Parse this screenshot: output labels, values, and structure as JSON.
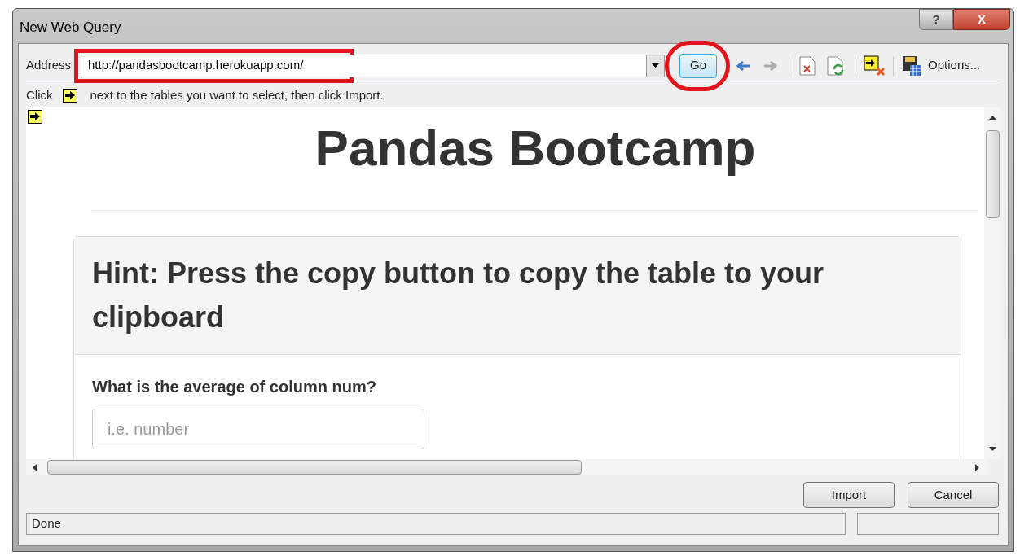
{
  "window": {
    "title": "New Web Query",
    "help_button": "?",
    "close_button": "X"
  },
  "address_bar": {
    "label": "Address",
    "value": "http://pandasbootcamp.herokuapp.com/",
    "go_button": "Go",
    "options_button": "Options..."
  },
  "instruction": {
    "before": "Click",
    "after": "next to the tables you want to select, then click Import."
  },
  "web_page": {
    "title": "Pandas Bootcamp",
    "panel_heading": "Hint: Press the copy button to copy the table to your clipboard",
    "question": "What is the average of column num?",
    "answer_placeholder": "i.e. number"
  },
  "buttons": [
    {
      "label": "Import"
    },
    {
      "label": "Cancel"
    }
  ],
  "status_bar": {
    "text": "Done"
  }
}
